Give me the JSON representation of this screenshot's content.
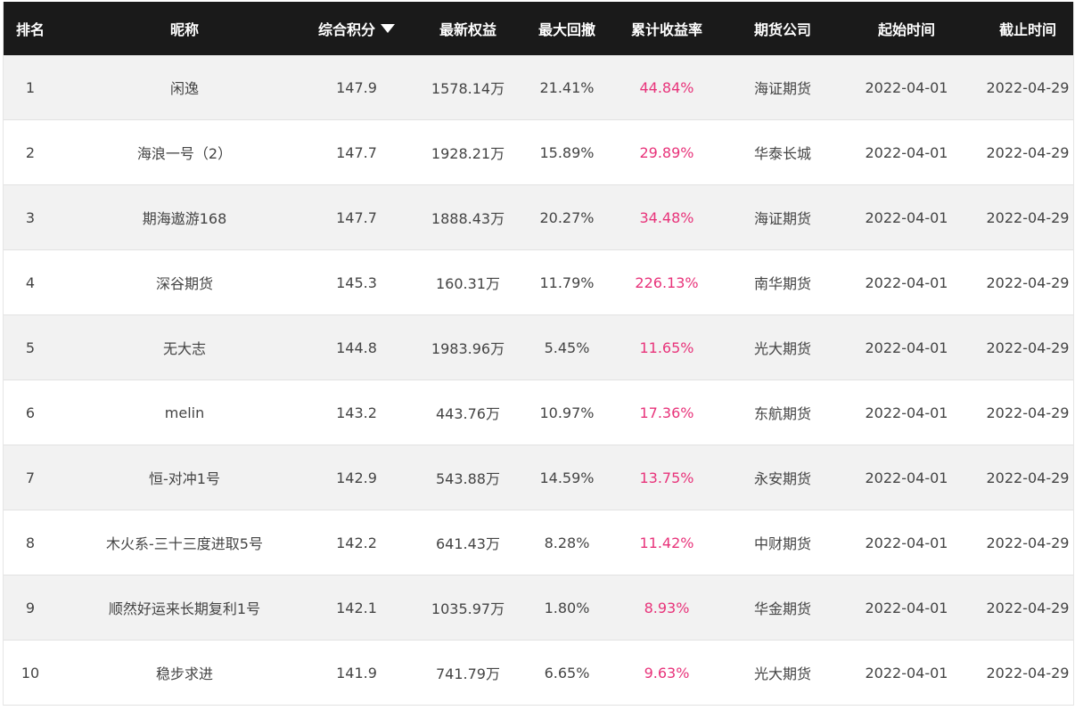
{
  "headers": {
    "rank": "排名",
    "name": "昵称",
    "score": "综合积分",
    "equity": "最新权益",
    "drawdown": "最大回撤",
    "return": "累计收益率",
    "company": "期货公司",
    "start": "起始时间",
    "end": "截止时间"
  },
  "sort_icon": "caret-down-icon",
  "accent_return_color": "#e8337a",
  "rows": [
    {
      "rank": "1",
      "name": "闲逸",
      "score": "147.9",
      "equity": "1578.14万",
      "drawdown": "21.41%",
      "return": "44.84%",
      "company": "海证期货",
      "start": "2022-04-01",
      "end": "2022-04-29"
    },
    {
      "rank": "2",
      "name": "海浪一号（2）",
      "score": "147.7",
      "equity": "1928.21万",
      "drawdown": "15.89%",
      "return": "29.89%",
      "company": "华泰长城",
      "start": "2022-04-01",
      "end": "2022-04-29"
    },
    {
      "rank": "3",
      "name": "期海遨游168",
      "score": "147.7",
      "equity": "1888.43万",
      "drawdown": "20.27%",
      "return": "34.48%",
      "company": "海证期货",
      "start": "2022-04-01",
      "end": "2022-04-29"
    },
    {
      "rank": "4",
      "name": "深谷期货",
      "score": "145.3",
      "equity": "160.31万",
      "drawdown": "11.79%",
      "return": "226.13%",
      "company": "南华期货",
      "start": "2022-04-01",
      "end": "2022-04-29"
    },
    {
      "rank": "5",
      "name": "无大志",
      "score": "144.8",
      "equity": "1983.96万",
      "drawdown": "5.45%",
      "return": "11.65%",
      "company": "光大期货",
      "start": "2022-04-01",
      "end": "2022-04-29"
    },
    {
      "rank": "6",
      "name": "melin",
      "score": "143.2",
      "equity": "443.76万",
      "drawdown": "10.97%",
      "return": "17.36%",
      "company": "东航期货",
      "start": "2022-04-01",
      "end": "2022-04-29"
    },
    {
      "rank": "7",
      "name": "恒-对冲1号",
      "score": "142.9",
      "equity": "543.88万",
      "drawdown": "14.59%",
      "return": "13.75%",
      "company": "永安期货",
      "start": "2022-04-01",
      "end": "2022-04-29"
    },
    {
      "rank": "8",
      "name": "木火系-三十三度进取5号",
      "score": "142.2",
      "equity": "641.43万",
      "drawdown": "8.28%",
      "return": "11.42%",
      "company": "中财期货",
      "start": "2022-04-01",
      "end": "2022-04-29"
    },
    {
      "rank": "9",
      "name": "顺然好运来长期复利1号",
      "score": "142.1",
      "equity": "1035.97万",
      "drawdown": "1.80%",
      "return": "8.93%",
      "company": "华金期货",
      "start": "2022-04-01",
      "end": "2022-04-29"
    },
    {
      "rank": "10",
      "name": "稳步求进",
      "score": "141.9",
      "equity": "741.79万",
      "drawdown": "6.65%",
      "return": "9.63%",
      "company": "光大期货",
      "start": "2022-04-01",
      "end": "2022-04-29"
    }
  ]
}
